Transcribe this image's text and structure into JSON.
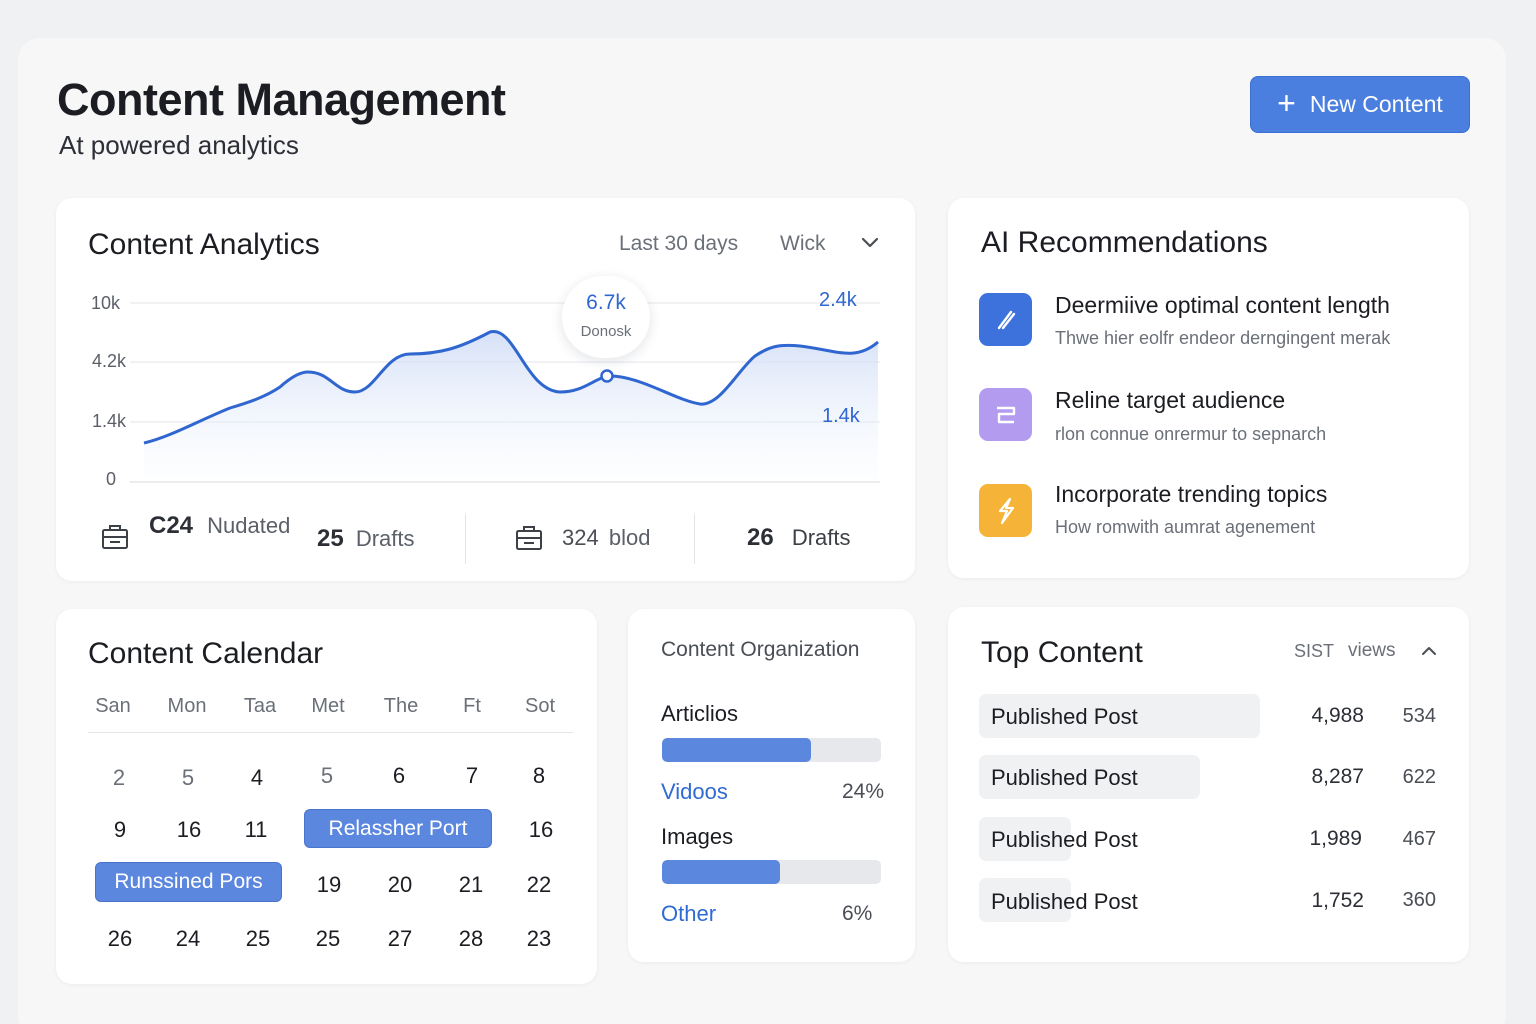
{
  "header": {
    "title": "Content Management",
    "subtitle": "At powered analytics",
    "new_button_label": "New Content"
  },
  "analytics": {
    "title": "Content Analytics",
    "range_label": "Last 30 days",
    "granularity_label": "Wick",
    "y_ticks": [
      "10k",
      "4.2k",
      "1.4k",
      "0"
    ],
    "tooltip_value": "6.7k",
    "tooltip_label": "Donosk",
    "label_high": "2.4k",
    "label_low": "1.4k",
    "stats": [
      {
        "number": "C24",
        "label": "Nudated"
      },
      {
        "number": "25",
        "label": "Drafts"
      },
      {
        "number": "324",
        "label": "blod"
      },
      {
        "number": "26",
        "label": "Drafts"
      }
    ],
    "colors": {
      "line": "#2f66d0",
      "accent": "#4a7fe0"
    }
  },
  "recommendations": {
    "title": "AI Recommendations",
    "items": [
      {
        "title": "Deermiive optimal content length",
        "desc": "Thwe hier eolfr endeor derngingent merak",
        "icon": "pencil-icon",
        "color": "#3d72dc"
      },
      {
        "title": "Reline target audience",
        "desc": "rlon connue onrermur to sepnarch",
        "icon": "card-icon",
        "color": "#b39cf0"
      },
      {
        "title": "Incorporate trending topics",
        "desc": "How romwith aumrat agenement",
        "icon": "bolt-icon",
        "color": "#f5b338"
      }
    ]
  },
  "calendar": {
    "title": "Content Calendar",
    "weekdays": [
      "San",
      "Mon",
      "Taa",
      "Met",
      "The",
      "Ft",
      "Sot"
    ],
    "row1": [
      "2",
      "5",
      "4",
      "5",
      "6",
      "7",
      "8"
    ],
    "row2": [
      "9",
      "16",
      "11",
      "16"
    ],
    "row2_event": "Relassher Port",
    "row3_event": "Runssined Pors",
    "row3": [
      "19",
      "20",
      "21",
      "22"
    ],
    "row4": [
      "26",
      "24",
      "25",
      "25",
      "27",
      "28",
      "23"
    ]
  },
  "organization": {
    "title": "Content Organization",
    "items": [
      {
        "label": "Articlios",
        "fill": 0.68
      },
      {
        "label": "Vidoos",
        "pct": "24%"
      },
      {
        "label": "Images",
        "fill": 0.54
      },
      {
        "label": "Other",
        "pct": "6%"
      }
    ]
  },
  "top_content": {
    "title": "Top Content",
    "col1_label": "SIST",
    "col2_label": "views",
    "rows": [
      {
        "label": "Published Post",
        "views": "4,988",
        "secondary": "534"
      },
      {
        "label": "Published Post",
        "views": "8,287",
        "secondary": "622"
      },
      {
        "label": "Published Post",
        "views": "1,989",
        "secondary": "467"
      },
      {
        "label": "Published Post",
        "views": "1,752",
        "secondary": "360"
      }
    ]
  }
}
